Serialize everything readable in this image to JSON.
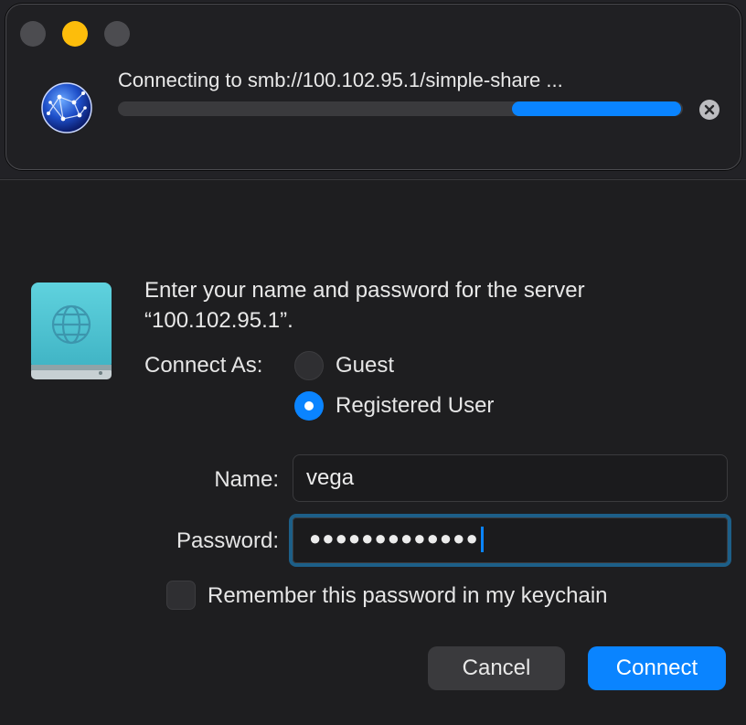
{
  "progress_window": {
    "status_text": "Connecting to smb://100.102.95.1/simple-share ...",
    "progress_fraction": 0.3,
    "icons": {
      "window_controls": [
        "close-icon",
        "minimize-icon",
        "zoom-icon"
      ],
      "app": "network-globe-icon",
      "stop": "stop-icon"
    },
    "colors": {
      "minimize": "#fdbd0b",
      "accent": "#0a84ff"
    }
  },
  "auth_dialog": {
    "prompt": "Enter your name and password for the server “100.102.95.1”.",
    "connect_as_label": "Connect As:",
    "options": [
      {
        "label": "Guest",
        "selected": false
      },
      {
        "label": "Registered User",
        "selected": true
      }
    ],
    "name_label": "Name:",
    "name_value": "vega",
    "password_label": "Password:",
    "password_masked": "●●●●●●●●●●●●●",
    "remember_label": "Remember this password in my keychain",
    "remember_checked": false,
    "cancel_label": "Cancel",
    "connect_label": "Connect",
    "icon": "network-disk-icon"
  }
}
